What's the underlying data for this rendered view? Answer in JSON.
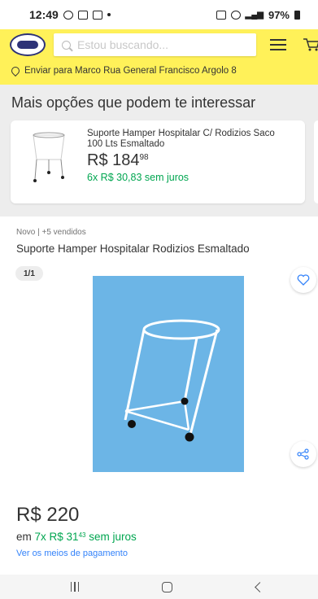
{
  "status_bar": {
    "time": "12:49",
    "battery": "97%"
  },
  "header": {
    "search_placeholder": "Estou buscando...",
    "address": "Enviar para Marco Rua General Francisco Argolo 8"
  },
  "recommendations": {
    "title": "Mais opções que podem te interessar",
    "items": [
      {
        "title": "Suporte Hamper Hospitalar C/ Rodizios Saco 100 Lts Esmaltado",
        "price_main": "R$ 184",
        "price_cents": "98",
        "installments": "6x R$ 30,83 sem juros"
      }
    ]
  },
  "product": {
    "meta": "Novo | +5 vendidos",
    "title": "Suporte Hamper Hospitalar Rodizios Esmaltado",
    "image_counter": "1/1",
    "price": "R$ 220",
    "installments_prefix": "em",
    "installments_value": "7x R$ 31",
    "installments_cents": "43",
    "installments_suffix": "sem juros",
    "payment_link": "Ver os meios de pagamento"
  },
  "colors": {
    "header_bg": "#fff159",
    "accent_green": "#00a650",
    "link_blue": "#3483fa",
    "image_bg": "#6cb5e6"
  }
}
